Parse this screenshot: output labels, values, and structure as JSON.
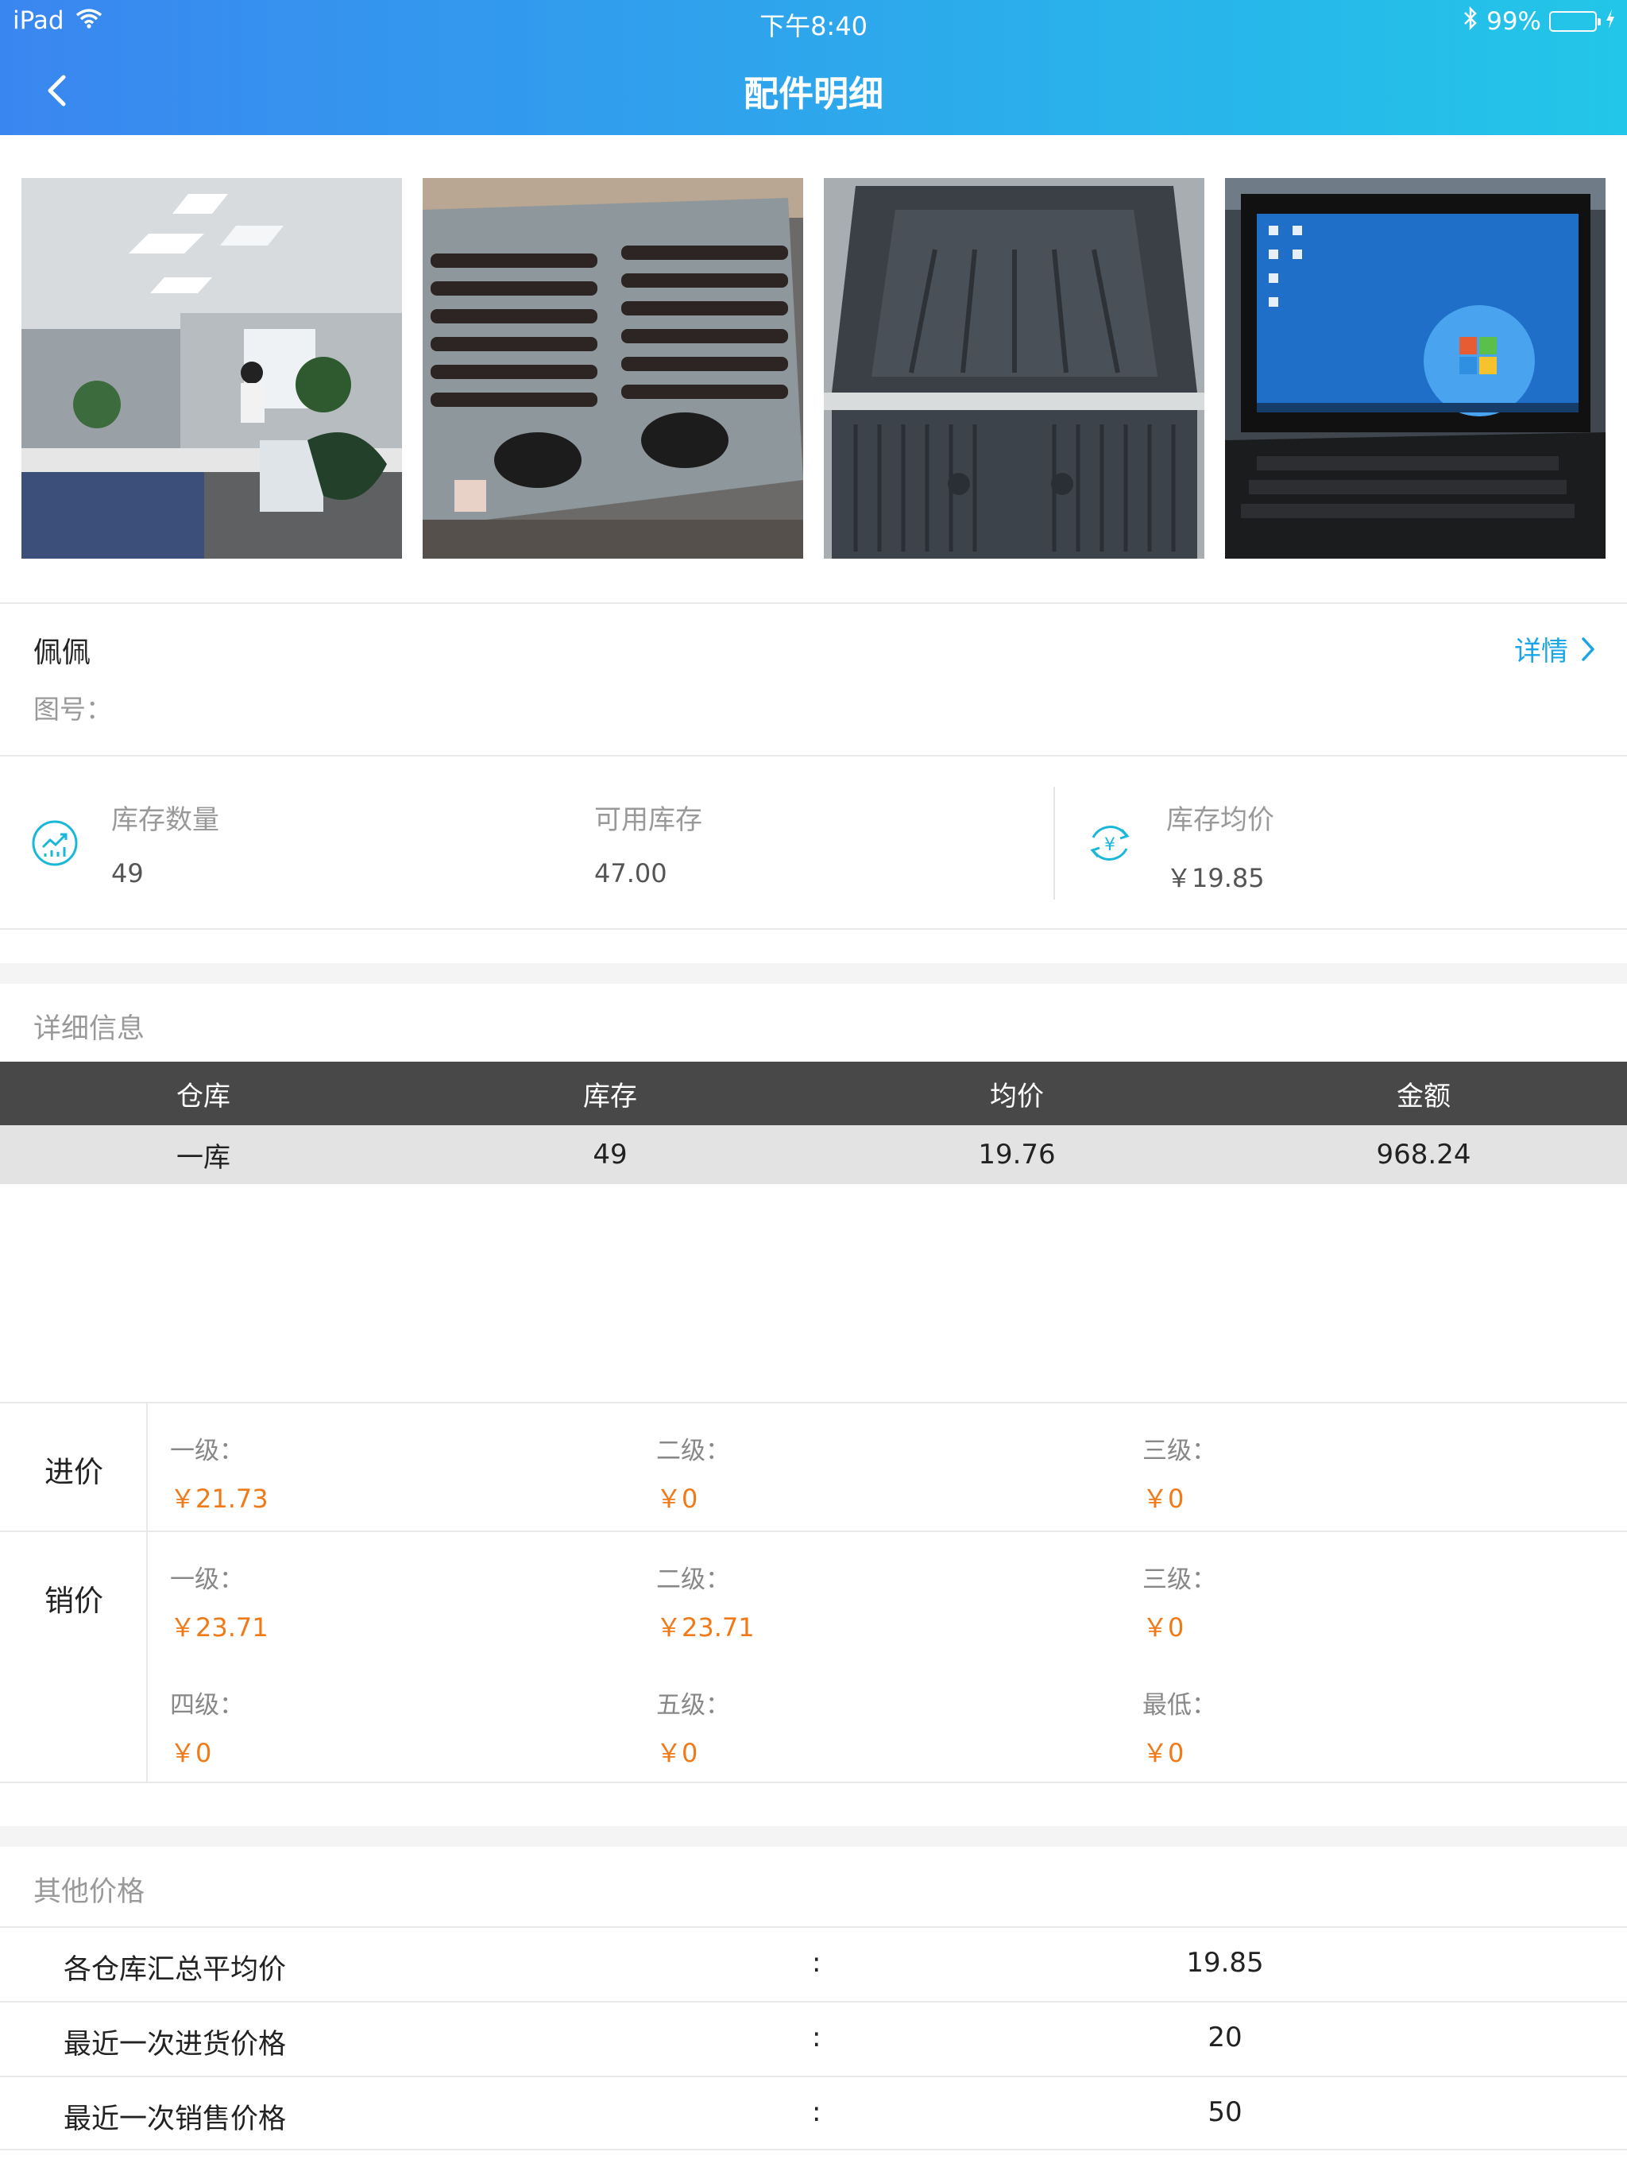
{
  "status_bar": {
    "device": "iPad",
    "time": "下午8:40",
    "battery": "99%"
  },
  "nav": {
    "title": "配件明细"
  },
  "images": [
    {
      "name": "office-photo"
    },
    {
      "name": "grille-part-photo"
    },
    {
      "name": "truck-bed-liner-photo"
    },
    {
      "name": "laptop-screen-photo"
    }
  ],
  "part": {
    "name": "佩佩",
    "drawing_label": "图号：",
    "detail_link": "详情"
  },
  "stats": {
    "stock_qty_label": "库存数量",
    "stock_qty_value": "49",
    "available_label": "可用库存",
    "available_value": "47.00",
    "avg_price_label": "库存均价",
    "avg_price_value": "￥19.85"
  },
  "details": {
    "section_title": "详细信息",
    "columns": [
      "仓库",
      "库存",
      "均价",
      "金额"
    ],
    "rows": [
      [
        "一库",
        "49",
        "19.76",
        "968.24"
      ]
    ]
  },
  "purchase_price": {
    "label": "进价",
    "items": [
      {
        "label": "一级：",
        "value": "￥21.73"
      },
      {
        "label": "二级：",
        "value": "￥0"
      },
      {
        "label": "三级：",
        "value": "￥0"
      }
    ]
  },
  "sale_price": {
    "label": "销价",
    "items": [
      {
        "label": "一级：",
        "value": "￥23.71"
      },
      {
        "label": "二级：",
        "value": "￥23.71"
      },
      {
        "label": "三级：",
        "value": "￥0"
      },
      {
        "label": "四级：",
        "value": "￥0"
      },
      {
        "label": "五级：",
        "value": "￥0"
      },
      {
        "label": "最低：",
        "value": "￥0"
      }
    ]
  },
  "other_prices": {
    "section_title": "其他价格",
    "rows": [
      {
        "label": "各仓库汇总平均价",
        "colon": ":",
        "value": "19.85"
      },
      {
        "label": "最近一次进货价格",
        "colon": ":",
        "value": "20"
      },
      {
        "label": "最近一次销售价格",
        "colon": ":",
        "value": "50"
      }
    ]
  },
  "colors": {
    "accent": "#1aa6e6",
    "price": "#f07a18",
    "table_header": "#484848",
    "header_start": "#3a86f0",
    "header_end": "#22c6e8"
  }
}
